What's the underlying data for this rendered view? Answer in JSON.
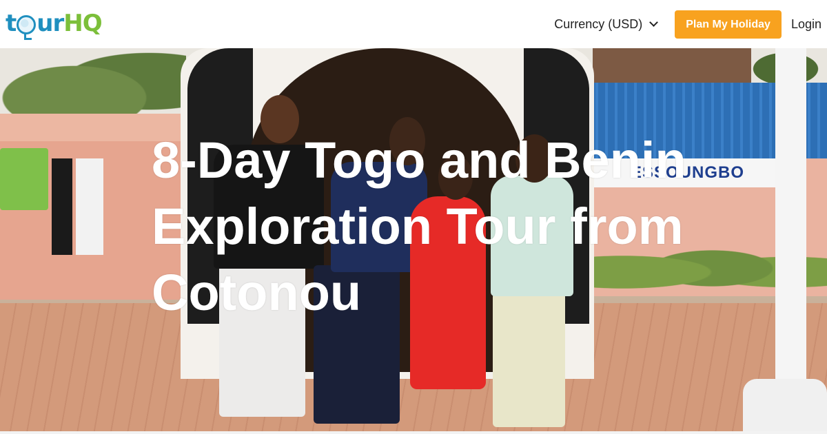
{
  "header": {
    "logo_text": "tourHQ",
    "currency_label": "Currency (USD)",
    "plan_button_label": "Plan My Holiday",
    "login_label": "Login"
  },
  "hero": {
    "title": "8-Day Togo and Benin Exploration Tour from Cotonou",
    "photo_sign_text": "ESSOUNGBO"
  },
  "colors": {
    "brand_blue": "#1f8fbf",
    "brand_green": "#7cbf3a",
    "cta_orange": "#f8a21f"
  },
  "icons": {
    "currency_dropdown": "chevron-down-icon"
  }
}
